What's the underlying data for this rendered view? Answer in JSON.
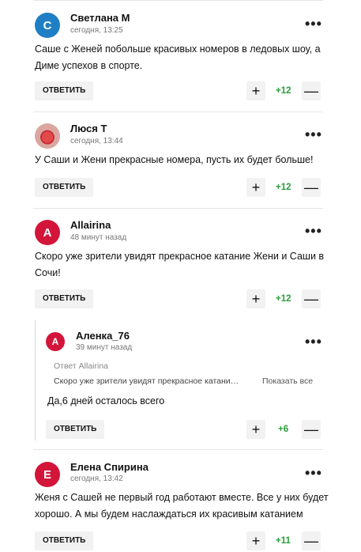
{
  "comments": [
    {
      "author": "Светлана М",
      "time": "сегодня, 13:25",
      "avatar_letter": "С",
      "avatar_color": "#1f7fc4",
      "text_lines": [
        "Саше с Женей побольше красивых номеров в ледовых шоу, а",
        "Диме успехов в спорте."
      ],
      "reply_label": "ОТВЕТИТЬ",
      "votes": "+12"
    },
    {
      "author": "Люся Т",
      "time": "сегодня, 13:44",
      "avatar_icon": "rose-icon",
      "text_lines": [
        "У Саши и Жени прекрасные номера, пусть их будет больше!"
      ],
      "reply_label": "ОТВЕТИТЬ",
      "votes": "+12"
    },
    {
      "author": "Allairina",
      "time": "48 минут назад",
      "avatar_letter": "A",
      "avatar_color": "#d3153a",
      "text_lines": [
        "Скоро уже зрители увидят прекрасное катание Жени и Саши в",
        "Сочи!"
      ],
      "reply_label": "ОТВЕТИТЬ",
      "votes": "+12"
    },
    {
      "author": "Аленка_76",
      "time": "39 минут назад",
      "avatar_letter": "А",
      "avatar_color": "#d3153a",
      "quote_head": "Ответ Allairina",
      "quote_text": "Скоро уже зрители увидят прекрасное катани…",
      "quote_more": "Показать все",
      "text_lines": [
        "Да,6 дней осталось всего"
      ],
      "reply_label": "ОТВЕТИТЬ",
      "votes": "+6"
    },
    {
      "author": "Елена Спирина",
      "time": "сегодня, 13:42",
      "avatar_letter": "Е",
      "avatar_color": "#d3153a",
      "text_lines": [
        "Женя с Сашей не первый год работают вместе. Все у них будет",
        "хорошо. А мы будем наслаждаться их красивым катанием"
      ],
      "reply_label": "ОТВЕТИТЬ",
      "votes": "+11"
    }
  ],
  "menu_symbol": "•••",
  "plus_symbol": "+",
  "minus_symbol": "—",
  "colors": {
    "positive": "#2a9d3a",
    "accent_red": "#d3153a",
    "accent_blue": "#1f7fc4"
  }
}
